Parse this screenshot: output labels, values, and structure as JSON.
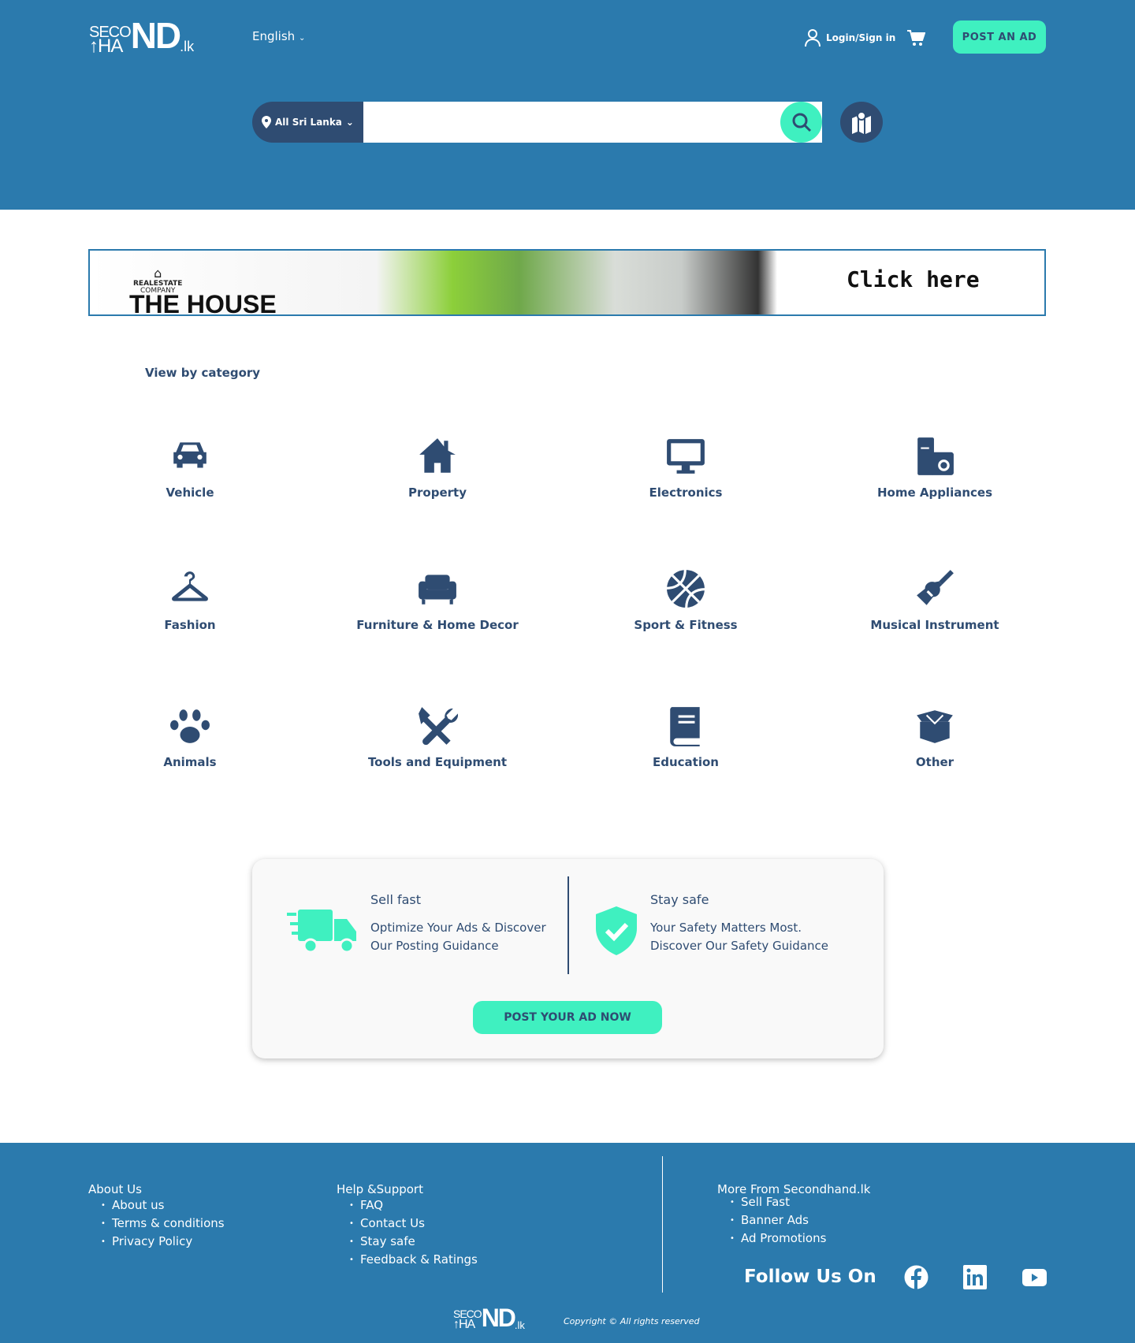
{
  "header": {
    "logo_top": "SECO",
    "logo_bottom": "HA",
    "logo_big": "ND",
    "logo_tld": ".lk",
    "language": "English",
    "login": "Login/Sign in",
    "post_ad": "POST AN AD"
  },
  "search": {
    "location": "All Sri Lanka",
    "placeholder": ""
  },
  "banner": {
    "company_line1": "REALESTATE",
    "company_line2": "COMPANY",
    "title": "THE HOUSE",
    "cta": "Click here"
  },
  "categories_title": "View by category",
  "categories": [
    {
      "label": "Vehicle",
      "icon": "car-icon"
    },
    {
      "label": "Property",
      "icon": "house-icon"
    },
    {
      "label": "Electronics",
      "icon": "monitor-icon"
    },
    {
      "label": "Home Appliances",
      "icon": "appliance-icon"
    },
    {
      "label": "Fashion",
      "icon": "hanger-icon"
    },
    {
      "label": "Furniture & Home Decor",
      "icon": "sofa-icon"
    },
    {
      "label": "Sport & Fitness",
      "icon": "basketball-icon"
    },
    {
      "label": "Musical Instrument",
      "icon": "guitar-icon"
    },
    {
      "label": "Animals",
      "icon": "paw-icon"
    },
    {
      "label": "Tools and Equipment",
      "icon": "tools-icon"
    },
    {
      "label": "Education",
      "icon": "book-icon"
    },
    {
      "label": "Other",
      "icon": "box-icon"
    }
  ],
  "promo": {
    "sell_title": "Sell fast",
    "sell_line1": "Optimize Your Ads & Discover",
    "sell_line2": "Our Posting Guidance",
    "safe_title": "Stay safe",
    "safe_line1": "Your Safety Matters Most.",
    "safe_line2": "Discover Our Safety Guidance",
    "button": "POST YOUR AD NOW"
  },
  "footer": {
    "about": {
      "title": "About Us",
      "items": [
        "About us",
        "Terms & conditions",
        "Privacy Policy"
      ]
    },
    "help": {
      "title": "Help &Support",
      "items": [
        "FAQ",
        "Contact Us",
        "Stay safe",
        "Feedback & Ratings"
      ]
    },
    "more": {
      "title": "More From Secondhand.lk",
      "items": [
        "Sell Fast",
        "Banner Ads",
        "Ad Promotions"
      ]
    },
    "follow": "Follow Us On",
    "copyright": "Copyright © All rights reserved"
  },
  "colors": {
    "primary": "#2b7aad",
    "navy": "#2f4c72",
    "accent": "#3ff0c0"
  }
}
